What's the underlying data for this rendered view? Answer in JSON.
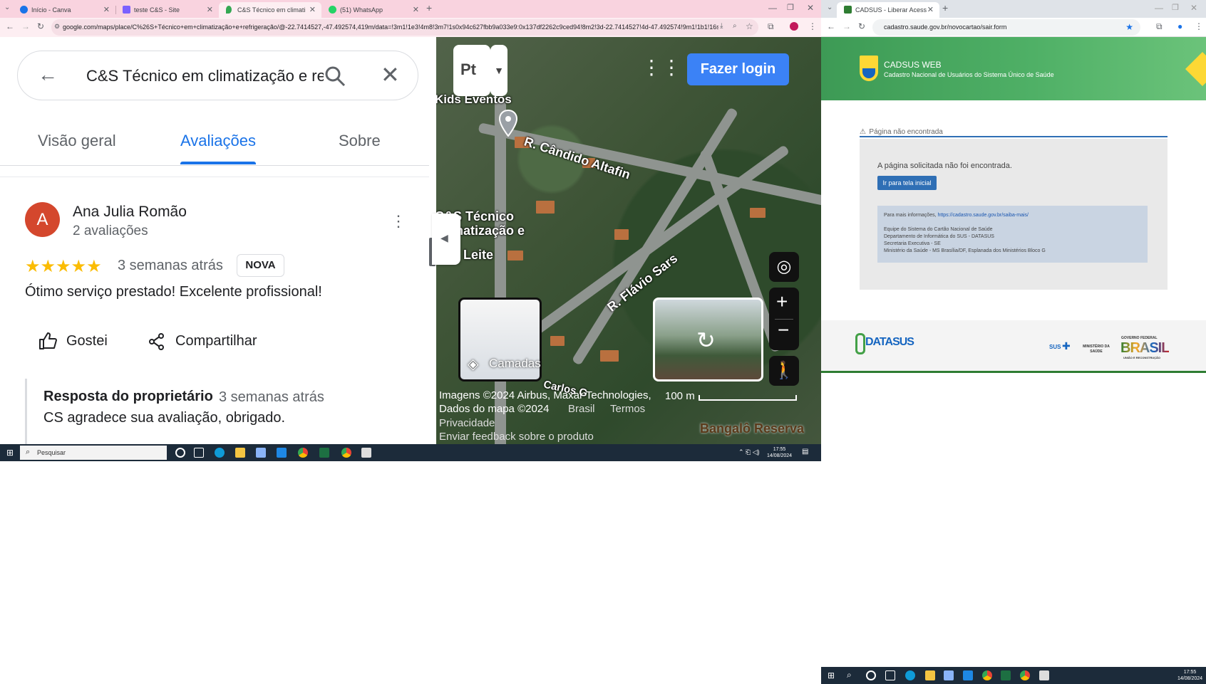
{
  "left_window": {
    "tabs": [
      {
        "label": "Início - Canva",
        "color": "#1a73e8"
      },
      {
        "label": "teste C&S - Site",
        "color": "#7b61ff"
      },
      {
        "label": "C&S Técnico em climatização e",
        "color": "#34a853"
      },
      {
        "label": "(51) WhatsApp",
        "color": "#25d366"
      }
    ],
    "new_tab": "+",
    "url": "google.com/maps/place/C%26S+Técnico+em+climatização+e+refrigeração/@-22.7414527,-47.492574,419m/data=!3m1!1e3!4m8!3m7!1s0x94c627fbb9a033e9:0x137df2262c9ced94!8m2!3d-22.7414527!4d-47.492574!9m1!1b1!16s%2Fg%2F11vj..."
  },
  "maps": {
    "search_query": "C&S Técnico em climatização e refrigeração",
    "tabs": [
      "Visão geral",
      "Avaliações",
      "Sobre"
    ],
    "review": {
      "avatar_letter": "A",
      "author": "Ana Julia Romão",
      "author_reviews": "2 avaliações",
      "stars": "★★★★★",
      "rating": 5,
      "time": "3 semanas atrás",
      "badge": "NOVA",
      "text": "Ótimo serviço prestado! Excelente profissional!",
      "like_label": "Gostei",
      "share_label": "Compartilhar",
      "reply_title": "Resposta do proprietário",
      "reply_time": "3 semanas atrás",
      "reply_text": "CS agradece sua avaliação, obrigado."
    },
    "map": {
      "login_label": "Fazer login",
      "layers_label": "Camadas",
      "labels": [
        "Kids Eventos",
        "R. Cândido Altafin",
        "C&S Técnico",
        "climatização e",
        "Leite",
        "R. Flávio Sars",
        "Carlos G",
        "Bangalô Reserva"
      ],
      "attribution_1": "Imagens ©2024 Airbus, Maxar Technologies,",
      "attribution_2": "Dados do mapa ©2024",
      "country": "Brasil",
      "terms": "Termos",
      "privacy": "Privacidade",
      "feedback": "Enviar feedback sobre o produto",
      "scale": "100 m"
    }
  },
  "taskbar": {
    "search_placeholder": "Pesquisar",
    "time": "17:55",
    "date": "14/08/2024",
    "notifications": "3"
  },
  "right_window": {
    "tab_label": "CADSUS - Liberar Acesso ao Re",
    "url": "cadastro.saude.gov.br/novocartao/sair.form",
    "header_title": "CADSUS WEB",
    "header_subtitle": "Cadastro Nacional de Usuários do Sistema Único de Saúde",
    "error_title": "Página não encontrada",
    "error_message": "A página solicitada não foi encontrada.",
    "home_button": "Ir para tela inicial",
    "info_prefix": "Para mais informações, ",
    "info_link": "https://cadastro.saude.gov.br/saiba-mais/",
    "info_lines": [
      "Equipe do Sistema do Cartão Nacional de Saúde",
      "Departamento de Informática do SUS - DATASUS",
      "Secretaria Executiva - SE",
      "Ministério da Saúde - MS Brasília/DF, Esplanada dos Ministérios Bloco G"
    ],
    "footer_datasus": "DATASUS",
    "footer_sus": "SUS",
    "footer_ministry": "MINISTÉRIO DA SAÚDE",
    "footer_gov": "GOVERNO FEDERAL",
    "footer_brasil": "BRASIL",
    "footer_gov_sub": "UNIÃO E RECONSTRUÇÃO"
  },
  "colors": {
    "maps_blue": "#1a73e8",
    "star": "#fbbc04",
    "avatar": "#d4472d",
    "cadsus_green": "#4fb066",
    "cadsus_button": "#2f6fb5"
  }
}
